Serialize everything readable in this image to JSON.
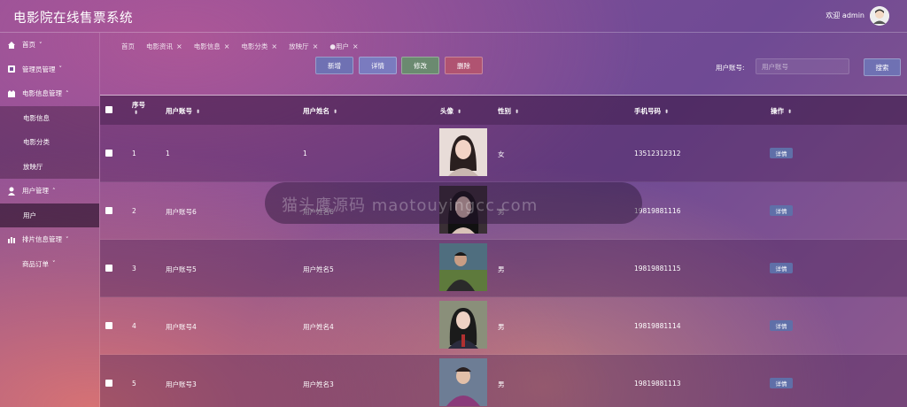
{
  "app": {
    "title": "电影院在线售票系统",
    "welcome": "欢迎 admin"
  },
  "sidebar": {
    "items": [
      {
        "label": "首页",
        "icon": "home-icon",
        "chevron": "˅"
      },
      {
        "label": "管理员管理",
        "icon": "admin-icon",
        "chevron": "˅"
      },
      {
        "label": "电影信息管理",
        "icon": "film-icon",
        "chevron": "˄"
      },
      {
        "label": "电影信息"
      },
      {
        "label": "电影分类"
      },
      {
        "label": "放映厅"
      },
      {
        "label": "用户管理",
        "icon": "user-icon",
        "chevron": "˄"
      },
      {
        "label": "用户"
      },
      {
        "label": "排片信息管理",
        "icon": "schedule-icon",
        "chevron": "˅"
      },
      {
        "label": "商品订单",
        "chevron": "˅"
      }
    ]
  },
  "tabs": [
    {
      "label": "首页"
    },
    {
      "label": "电影资讯",
      "close": "×"
    },
    {
      "label": "电影信息",
      "close": "×"
    },
    {
      "label": "电影分类",
      "close": "×"
    },
    {
      "label": "放映厅",
      "close": "×"
    },
    {
      "label": "●用户",
      "close": "×"
    }
  ],
  "toolbar": {
    "new": "新增",
    "detail": "详情",
    "edit": "修改",
    "delete": "删除",
    "search_label": "用户账号:",
    "search_placeholder": "用户账号",
    "search": "搜索"
  },
  "table": {
    "headers": {
      "index": "序号",
      "account": "用户账号",
      "name": "用户姓名",
      "avatar": "头像",
      "gender": "性别",
      "phone": "手机号码",
      "action": "操作"
    },
    "sort_icon": "⬍",
    "rows": [
      {
        "index": "1",
        "account": "1",
        "name": "1",
        "gender": "女",
        "phone": "13512312312",
        "action": "详情"
      },
      {
        "index": "2",
        "account": "用户账号6",
        "name": "用户姓名6",
        "gender": "男",
        "phone": "19819881116",
        "action": "详情"
      },
      {
        "index": "3",
        "account": "用户账号5",
        "name": "用户姓名5",
        "gender": "男",
        "phone": "19819881115",
        "action": "详情"
      },
      {
        "index": "4",
        "account": "用户账号4",
        "name": "用户姓名4",
        "gender": "男",
        "phone": "19819881114",
        "action": "详情"
      },
      {
        "index": "5",
        "account": "用户账号3",
        "name": "用户姓名3",
        "gender": "男",
        "phone": "19819881113",
        "action": "详情"
      }
    ]
  },
  "watermark": "猫头鹰源码 maotouyingcc.com"
}
